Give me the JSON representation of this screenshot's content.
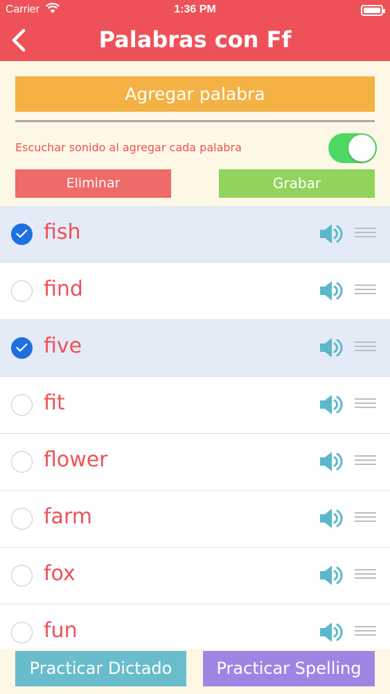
{
  "status_bar": {
    "carrier": "Carrier",
    "time": "1:36 PM"
  },
  "nav": {
    "title": "Palabras con Ff",
    "back_icon": "chevron-left-icon"
  },
  "controls": {
    "add_word": "Agregar palabra",
    "sound_label": "Escuchar sonido al agregar cada palabra",
    "sound_toggle_on": true,
    "delete_label": "Eliminar",
    "record_label": "Grabar"
  },
  "words": [
    {
      "text": "fish",
      "selected": true
    },
    {
      "text": "find",
      "selected": false
    },
    {
      "text": "five",
      "selected": true
    },
    {
      "text": "fit",
      "selected": false
    },
    {
      "text": "flower",
      "selected": false
    },
    {
      "text": "farm",
      "selected": false
    },
    {
      "text": "fox",
      "selected": false
    },
    {
      "text": "fun",
      "selected": false
    }
  ],
  "bottom": {
    "dictation_label": "Practicar Dictado",
    "spelling_label": "Practicar Spelling"
  },
  "colors": {
    "header": "#ef5158",
    "add_word": "#f4b244",
    "delete": "#ee6b68",
    "record": "#90d45c",
    "selected_row": "#e4ebf7",
    "check": "#1f6fe0",
    "speaker": "#5bb8c9",
    "dictation": "#69bccc",
    "spelling": "#9f85e3"
  }
}
